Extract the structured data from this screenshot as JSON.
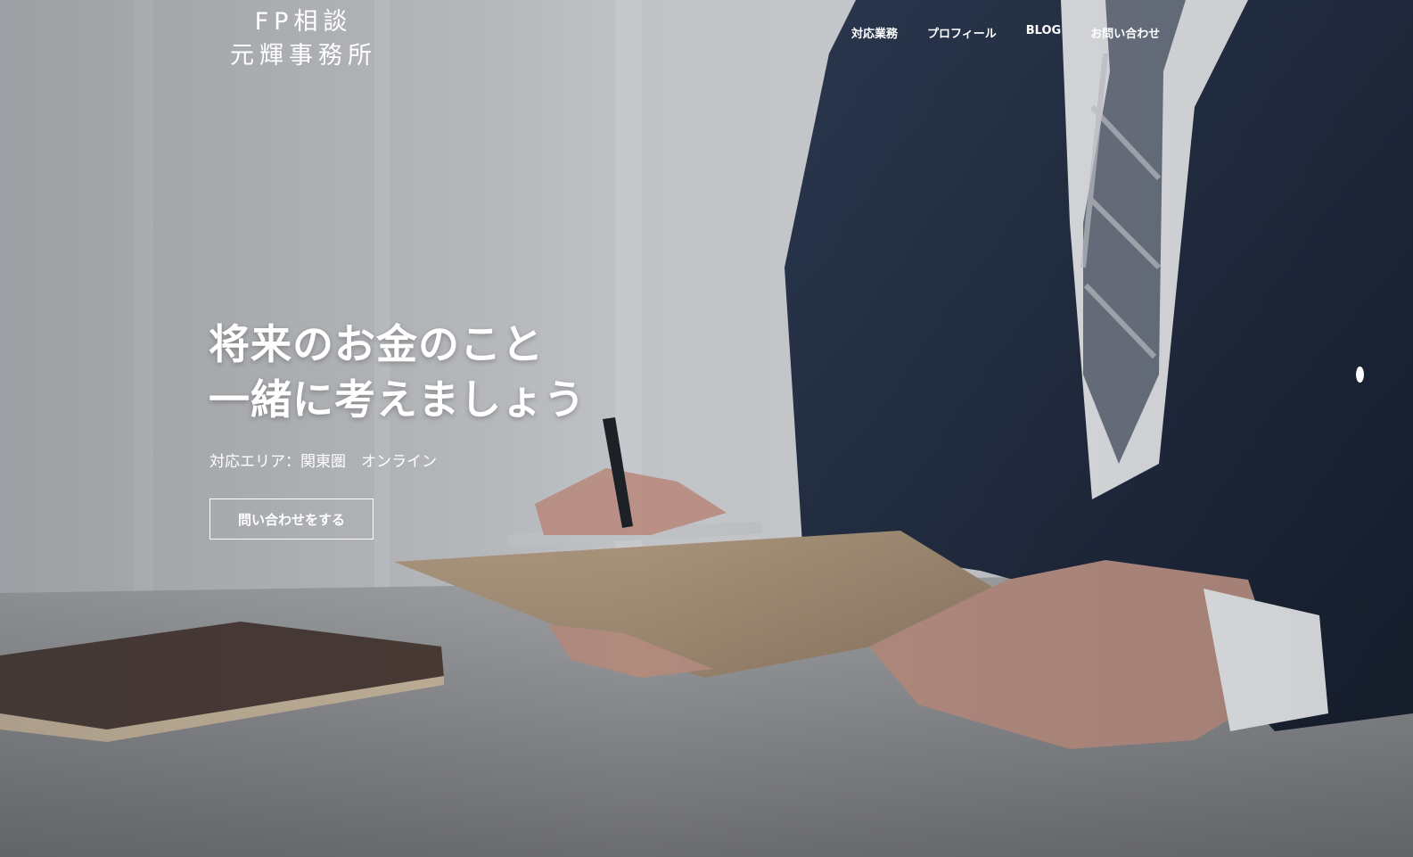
{
  "logo": {
    "line1": "FP相談",
    "line2": "元輝事務所"
  },
  "nav": {
    "items": [
      {
        "label": "対応業務"
      },
      {
        "label": "プロフィール"
      },
      {
        "label": "BLOG"
      },
      {
        "label": "お問い合わせ"
      }
    ]
  },
  "hero": {
    "headline_line1": "将来のお金のこと",
    "headline_line2": "一緒に考えましょう",
    "subtitle": "対応エリア：関東圏　オンライン",
    "cta_label": "問い合わせをする"
  },
  "colors": {
    "text": "#ffffff",
    "suit": "#1e2a40",
    "desk": "#8a8c8f"
  }
}
